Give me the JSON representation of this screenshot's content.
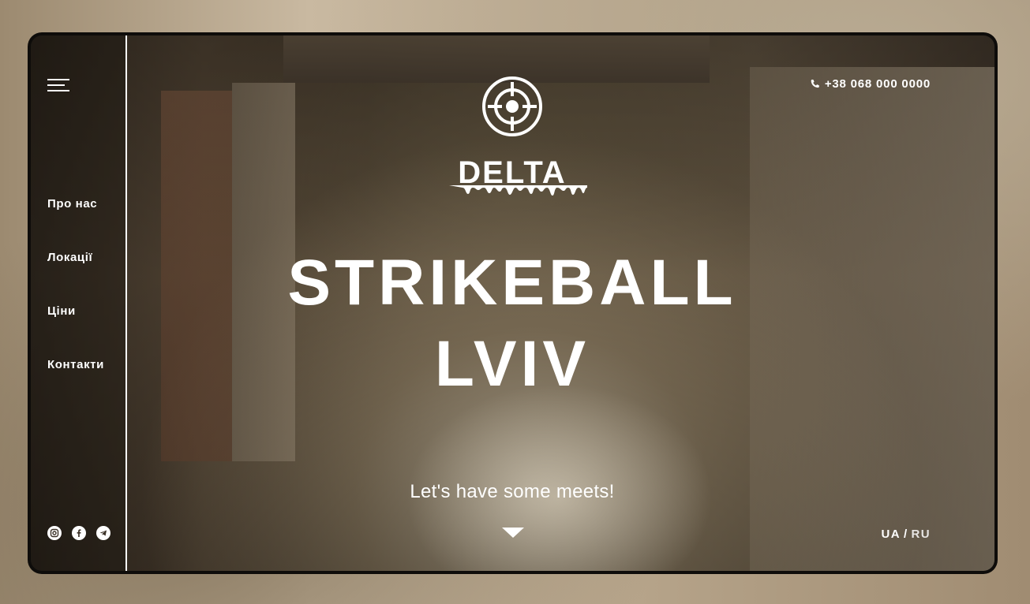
{
  "header": {
    "brand_name": "DELTA",
    "phone": "+38 068 000 0000"
  },
  "nav": {
    "items": [
      {
        "label": "Про нас"
      },
      {
        "label": "Локації"
      },
      {
        "label": "Ціни"
      },
      {
        "label": "Контакти"
      }
    ]
  },
  "hero": {
    "title_line1": "STRIKEBALL",
    "title_line2": "LVIV",
    "tagline": "Let's have some meets!"
  },
  "language": {
    "current": "UA",
    "separator": "/",
    "other": "RU"
  },
  "social": [
    {
      "icon": "instagram-icon"
    },
    {
      "icon": "facebook-icon"
    },
    {
      "icon": "telegram-icon"
    }
  ],
  "colors": {
    "text": "#ffffff",
    "frame": "#0e0c0a"
  }
}
